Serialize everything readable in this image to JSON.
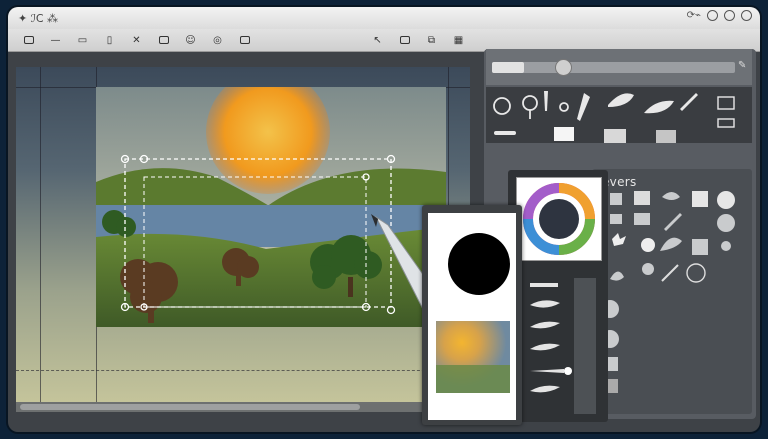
{
  "window": {
    "title_glyph": "✦  ℐC  ⁂"
  },
  "toolbar": {
    "tools": [
      "rect",
      "line",
      "video",
      "box",
      "x",
      "camera",
      "emoji",
      "plugin",
      "note"
    ],
    "right_tools": [
      "cursor",
      "image",
      "layers",
      "grid"
    ]
  },
  "panel": {
    "opacity_value": 0.32,
    "section_label": "evers"
  },
  "colors": {
    "window_bg": "#3e4247",
    "panel_bg": "#585c62",
    "sun": "#f1a31f",
    "grass": "#57752f",
    "water": "#6585a5"
  }
}
